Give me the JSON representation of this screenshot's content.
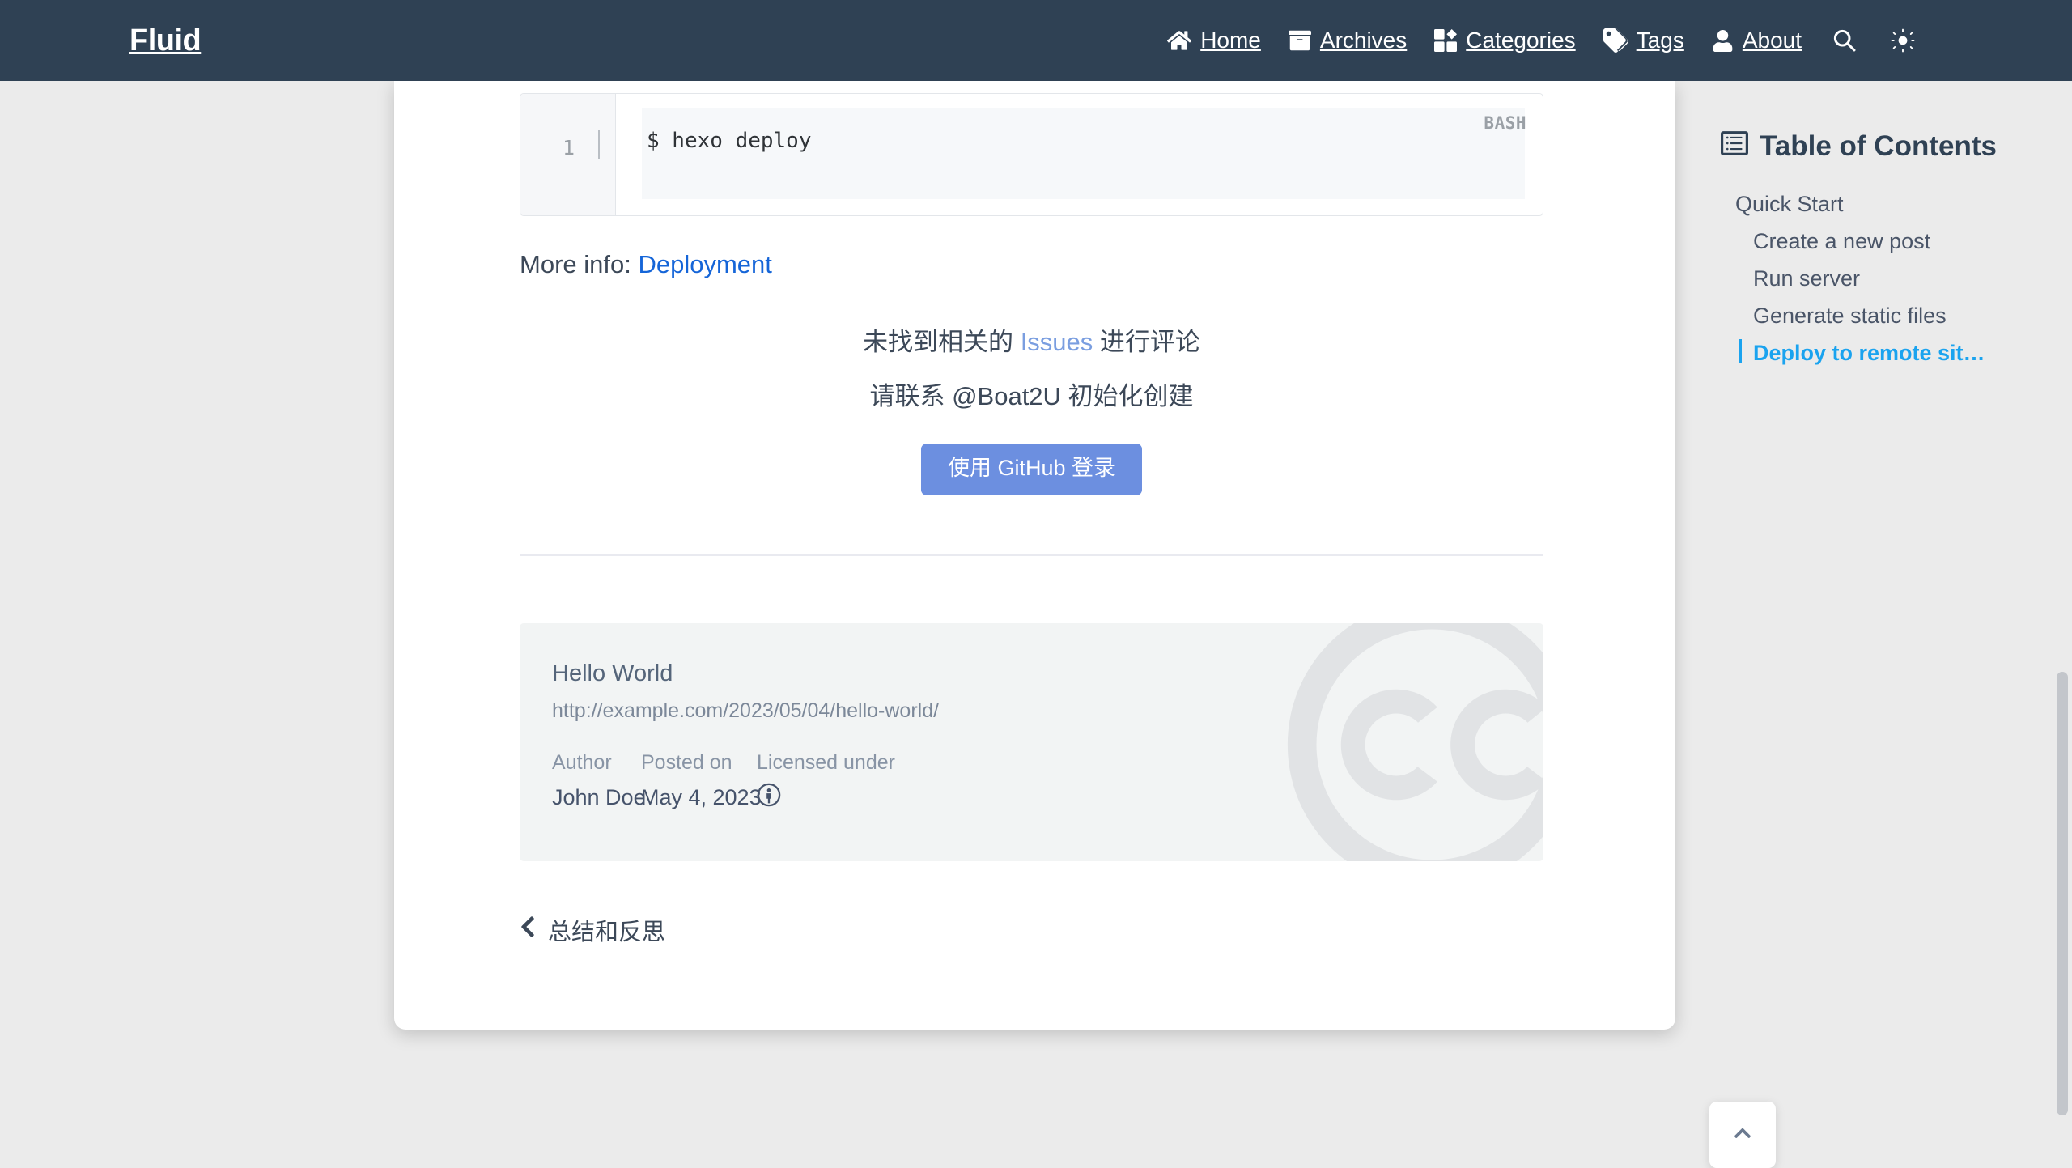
{
  "header": {
    "brand": "Fluid",
    "nav": [
      {
        "label": "Home",
        "icon": "home-icon"
      },
      {
        "label": "Archives",
        "icon": "archive-box-icon"
      },
      {
        "label": "Categories",
        "icon": "categories-icon"
      },
      {
        "label": "Tags",
        "icon": "tag-icon"
      },
      {
        "label": "About",
        "icon": "user-icon"
      }
    ],
    "search_icon": "search-icon",
    "theme_icon": "sun-icon",
    "bg_color": "#2f4154"
  },
  "code_block": {
    "line_number": "1",
    "language": "BASH",
    "code": "$ hexo deploy"
  },
  "more_info": {
    "prefix": "More info:",
    "link_text": "Deployment",
    "link_color": "#1565d8"
  },
  "comments": {
    "line1_before": "未找到相关的",
    "line1_link": "Issues",
    "line1_after": "进行评论",
    "line2": "请联系 @Boat2U 初始化创建",
    "login_button": "使用 GitHub 登录",
    "button_color": "#6c8fe0"
  },
  "post_card": {
    "title": "Hello World",
    "url": "http://example.com/2023/05/04/hello-world/",
    "meta": [
      {
        "key": "Author",
        "value": "John Doe"
      },
      {
        "key": "Posted on",
        "value": "May 4, 2023"
      },
      {
        "key": "Licensed under",
        "value": "",
        "icon": "cc-by-icon"
      }
    ],
    "watermark_icon": "creative-commons-watermark-icon"
  },
  "prev_post": {
    "icon": "chevron-left-icon",
    "label": "总结和反思"
  },
  "toc": {
    "icon": "list-table-icon",
    "title": "Table of Contents",
    "active_color": "#1aa3ef",
    "items": [
      {
        "label": "Quick Start",
        "level": 1,
        "active": false
      },
      {
        "label": "Create a new post",
        "level": 2,
        "active": false
      },
      {
        "label": "Run server",
        "level": 2,
        "active": false
      },
      {
        "label": "Generate static files",
        "level": 2,
        "active": false
      },
      {
        "label": "Deploy to remote sit…",
        "level": 2,
        "active": true
      }
    ]
  },
  "back_to_top": {
    "icon": "chevron-up-icon"
  }
}
